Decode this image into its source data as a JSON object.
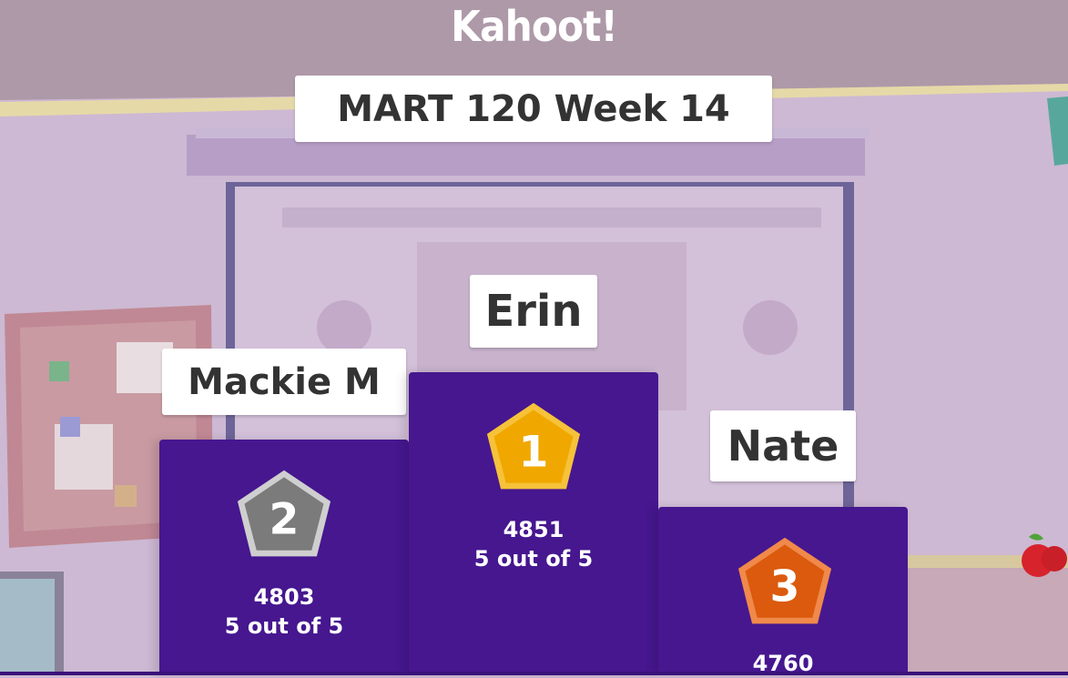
{
  "app": {
    "logo_text": "Kahoot!"
  },
  "quiz": {
    "title": "MART 120 Week 14"
  },
  "podium": {
    "first": {
      "rank": "1",
      "name": "Erin",
      "score": "4851",
      "correct": "5 out of 5"
    },
    "second": {
      "rank": "2",
      "name": "Mackie M",
      "score": "4803",
      "correct": "5 out of 5"
    },
    "third": {
      "rank": "3",
      "name": "Nate",
      "score": "4760"
    }
  },
  "colors": {
    "podium": "#46178f",
    "gold": "#f4b400",
    "silver": "#8a8a8a",
    "bronze": "#e06417",
    "card_text": "#333333"
  },
  "icons": [
    "gold-medal-icon",
    "silver-medal-icon",
    "bronze-medal-icon",
    "apple-icon"
  ]
}
